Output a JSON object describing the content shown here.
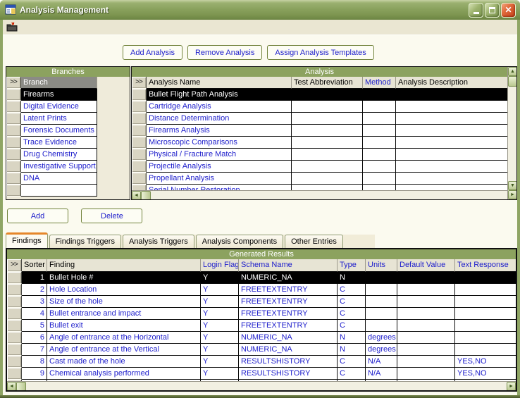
{
  "colors": {
    "accent_green": "#8CA25F",
    "link_blue": "#2020CC",
    "selected_row_bg": "#000000",
    "tab_orange": "#E5862A",
    "titlebar_green": "#7D9550",
    "close_red": "#C4401A",
    "toolbar_beige": "#EAE6D2"
  },
  "window": {
    "title": "Analysis Management"
  },
  "top_buttons": {
    "add_analysis": "Add Analysis",
    "remove_analysis": "Remove Analysis",
    "assign_templates": "Assign Analysis Templates"
  },
  "branches": {
    "title": "Branches",
    "selector_header": ">>",
    "column_header": "Branch",
    "selected": "Firearms",
    "items": [
      "Firearms",
      "Digital Evidence",
      "Latent Prints",
      "Forensic Documents",
      "Trace Evidence",
      "Drug Chemistry",
      "Investigative Support",
      "DNA"
    ]
  },
  "analysis": {
    "title": "Analysis",
    "selector_header": ">>",
    "columns": [
      {
        "label": "Analysis Name",
        "blue": false
      },
      {
        "label": "Test Abbreviation",
        "blue": false
      },
      {
        "label": "Method",
        "blue": true
      },
      {
        "label": "Analysis Description",
        "blue": false
      }
    ],
    "selected": "Bullet Flight Path Analysis",
    "rows": [
      "Bullet Flight Path Analysis",
      "Cartridge Analysis",
      "Distance Determination",
      "Firearms Analysis",
      "Microscopic Comparisons",
      "Physical / Fracture Match",
      "Projectile Analysis",
      "Propellant Analysis"
    ],
    "partial_row": "Serial Number Restoration"
  },
  "edit_buttons": {
    "add": "Add",
    "delete": "Delete"
  },
  "tabs": {
    "active": "Findings",
    "items": [
      "Findings",
      "Findings Triggers",
      "Analysis Triggers",
      "Analysis Components",
      "Other Entries"
    ]
  },
  "generated_results": {
    "title": "Generated Results",
    "selector_header": ">>",
    "selected_sorter": "1",
    "columns": [
      {
        "label": "Sorter",
        "blue": false
      },
      {
        "label": "Finding",
        "blue": false
      },
      {
        "label": "Login Flag",
        "blue": true
      },
      {
        "label": "Schema Name",
        "blue": true
      },
      {
        "label": "Type",
        "blue": true
      },
      {
        "label": "Units",
        "blue": true
      },
      {
        "label": "Default Value",
        "blue": true
      },
      {
        "label": "Text Response",
        "blue": true
      }
    ],
    "rows": [
      {
        "sorter": "1",
        "finding": "Bullet Hole #",
        "login_flag": "Y",
        "schema_name": "NUMERIC_NA",
        "type": "N",
        "units": "",
        "default_value": "",
        "text_response": ""
      },
      {
        "sorter": "2",
        "finding": "Hole Location",
        "login_flag": "Y",
        "schema_name": "FREETEXTENTRY",
        "type": "C",
        "units": "",
        "default_value": "",
        "text_response": ""
      },
      {
        "sorter": "3",
        "finding": "Size of the hole",
        "login_flag": "Y",
        "schema_name": "FREETEXTENTRY",
        "type": "C",
        "units": "",
        "default_value": "",
        "text_response": ""
      },
      {
        "sorter": "4",
        "finding": "Bullet entrance and impact",
        "login_flag": "Y",
        "schema_name": "FREETEXTENTRY",
        "type": "C",
        "units": "",
        "default_value": "",
        "text_response": ""
      },
      {
        "sorter": "5",
        "finding": "Bullet exit",
        "login_flag": "Y",
        "schema_name": "FREETEXTENTRY",
        "type": "C",
        "units": "",
        "default_value": "",
        "text_response": ""
      },
      {
        "sorter": "6",
        "finding": "Angle of entrance at the Horizontal",
        "login_flag": "Y",
        "schema_name": "NUMERIC_NA",
        "type": "N",
        "units": "degrees",
        "default_value": "",
        "text_response": ""
      },
      {
        "sorter": "7",
        "finding": "Angle of entrance at the Vertical",
        "login_flag": "Y",
        "schema_name": "NUMERIC_NA",
        "type": "N",
        "units": "degrees",
        "default_value": "",
        "text_response": ""
      },
      {
        "sorter": "8",
        "finding": "Cast made of the hole",
        "login_flag": "Y",
        "schema_name": "RESULTSHISTORY",
        "type": "C",
        "units": "N/A",
        "default_value": "",
        "text_response": "YES,NO"
      },
      {
        "sorter": "9",
        "finding": "Chemical analysis performed",
        "login_flag": "Y",
        "schema_name": "RESULTSHISTORY",
        "type": "C",
        "units": "N/A",
        "default_value": "",
        "text_response": "YES,NO"
      }
    ]
  }
}
